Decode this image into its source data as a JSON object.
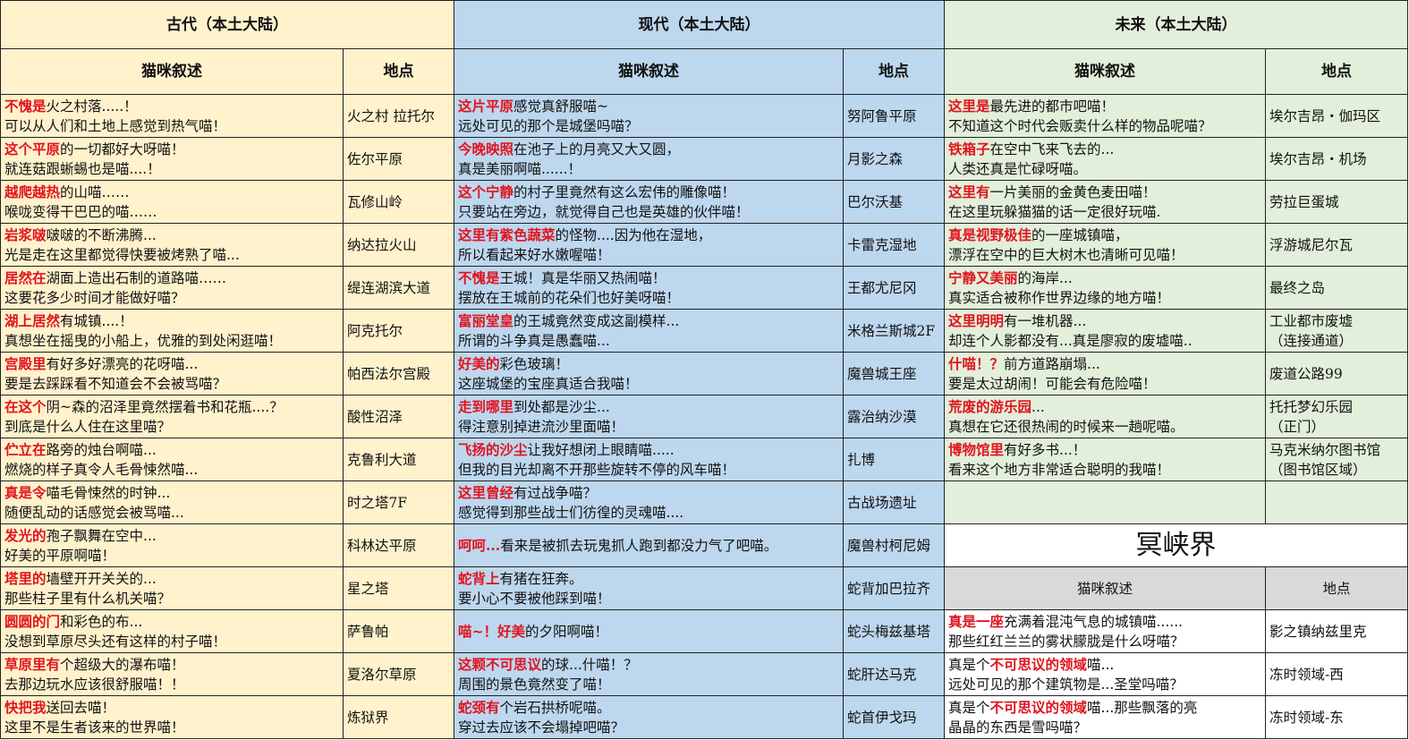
{
  "ancient": {
    "title": "古代（本土大陆）",
    "col_narration": "猫咪叙述",
    "col_location": "地点",
    "rows": [
      {
        "hl": "不愧是",
        "l1": "火之村落.....！",
        "l2": "可以从人们和土地上感觉到热气喵！",
        "loc": "火之村 拉托尔"
      },
      {
        "hl": "这个平原",
        "l1": "的一切都好大呀喵！",
        "l2": "就连菇跟蜥蜴也是喵....！",
        "loc": "佐尔平原"
      },
      {
        "hl": "越爬越热",
        "l1": "的山喵……",
        "l2": "喉咙变得干巴巴的喵……",
        "loc": "瓦修山岭"
      },
      {
        "hl": "岩浆啵",
        "l1": "啵啵的不断沸腾...",
        "l2": "光是走在这里都觉得快要被烤熟了喵...",
        "loc": "纳达拉火山"
      },
      {
        "hl": "居然在",
        "l1": "湖面上造出石制的道路喵……",
        "l2": "这要花多少时间才能做好喵？",
        "loc": "缇连湖滨大道"
      },
      {
        "hl": "湖上居然",
        "l1": "有城镇....！",
        "l2": "真想坐在摇曳的小船上，优雅的到处闲逛喵！",
        "loc": "阿克托尔"
      },
      {
        "hl": "宫殿里",
        "l1": "有好多好漂亮的花呀喵...",
        "l2": "要是去踩踩看不知道会不会被骂喵？",
        "loc": "帕西法尔宫殿"
      },
      {
        "hl": "在这个",
        "l1": "阴~森的沼泽里竟然摆着书和花瓶....？",
        "l2": "到底是什么人住在这里喵？",
        "loc": "酸性沼泽"
      },
      {
        "hl": "伫立在",
        "l1": "路旁的烛台啊喵...",
        "l2": "燃烧的样子真令人毛骨悚然喵...",
        "loc": "克鲁利大道"
      },
      {
        "hl": "真是令",
        "l1": "喵毛骨悚然的时钟...",
        "l2": "随便乱动的话感觉会被骂喵...",
        "loc": "时之塔7F"
      },
      {
        "hl": "发光的",
        "l1": "孢子飘舞在空中...",
        "l2": "好美的平原啊喵！",
        "loc": "科林达平原"
      },
      {
        "hl": "塔里的",
        "l1": "墙壁开开关关的...",
        "l2": "那些柱子里有什么机关喵？",
        "loc": "星之塔"
      },
      {
        "hl": "圆圆的门",
        "l1": "和彩色的布...",
        "l2": "没想到草原尽头还有这样的村子喵！",
        "loc": "萨鲁帕"
      },
      {
        "hl": "草原里有",
        "l1": "个超级大的瀑布喵！",
        "l2": "去那边玩水应该很舒服喵！！",
        "loc": "夏洛尔草原"
      },
      {
        "hl": "快把我",
        "l1": "送回去喵！",
        "l2": "这里不是生者该来的世界喵！",
        "loc": "炼狱界"
      }
    ]
  },
  "modern": {
    "title": "现代（本土大陆）",
    "col_narration": "猫咪叙述",
    "col_location": "地点",
    "rows": [
      {
        "hl": "这片平原",
        "l1": "感觉真舒服喵~",
        "l2": "远处可见的那个是城堡吗喵？",
        "loc": "努阿鲁平原"
      },
      {
        "hl": "今晚映照",
        "l1": "在池子上的月亮又大又圆，",
        "l2": "真是美丽啊喵......！",
        "loc": "月影之森"
      },
      {
        "hl": "这个宁静",
        "l1": "的村子里竟然有这么宏伟的雕像喵！",
        "l2": "只要站在旁边，就觉得自己也是英雄的伙伴喵！",
        "loc": "巴尔沃基"
      },
      {
        "hl": "这里有紫色蔬菜",
        "l1": "的怪物....因为他在湿地，",
        "l2": "所以看起来好水嫩喔喵！",
        "loc": "卡雷克湿地"
      },
      {
        "hl": "不愧是",
        "l1": "王城！真是华丽又热闹喵！",
        "l2": "摆放在王城前的花朵们也好美呀喵！",
        "loc": "王都尤尼冈"
      },
      {
        "hl": "富丽堂皇",
        "l1": "的王城竟然变成这副模样...",
        "l2": "所谓的斗争真是愚蠢喵...",
        "loc": "米格兰斯城2F"
      },
      {
        "hl": "好美的",
        "l1": "彩色玻璃！",
        "l2": "这座城堡的宝座真适合我喵！",
        "loc": "魔兽城王座"
      },
      {
        "hl": "走到哪里",
        "l1": "到处都是沙尘...",
        "l2": "得注意别掉进流沙里面喵！",
        "loc": "露治纳沙漠"
      },
      {
        "hl": "飞扬的沙尘",
        "l1": "让我好想闭上眼睛喵.....",
        "l2": "但我的目光却离不开那些旋转不停的风车喵！",
        "loc": "扎博"
      },
      {
        "hl": "这里曾经",
        "l1": "有过战争喵？",
        "l2": "感觉得到那些战士们彷徨的灵魂喵....",
        "loc": "古战场遗址"
      },
      {
        "hl": "呵呵...",
        "l1": "看来是被抓去玩鬼抓人跑到都没力气了吧喵。",
        "l2": "",
        "loc": "魔兽村柯尼姆"
      },
      {
        "hl": "蛇背上",
        "l1": "有猪在狂奔。",
        "l2": "要小心不要被他踩到喵！",
        "loc": "蛇背加巴拉齐"
      },
      {
        "hl": "喵~！好美",
        "l1": "的夕阳啊喵！",
        "l2": "",
        "loc": "蛇头梅兹基塔"
      },
      {
        "hl": "这颗不可思议",
        "l1": "的球...什喵！？",
        "l2": "周围的景色竟然变了喵！",
        "loc": "蛇肝达马克"
      },
      {
        "hl": "蛇颈有",
        "l1": "个岩石拱桥呢喵。",
        "l2": "穿过去应该不会塌掉吧喵？",
        "loc": "蛇首伊戈玛"
      }
    ]
  },
  "future": {
    "title": "未来（本土大陆）",
    "col_narration": "猫咪叙述",
    "col_location": "地点",
    "rows": [
      {
        "hl": "这里是",
        "l1": "最先进的都市吧喵！",
        "l2": "不知道这个时代会贩卖什么样的物品呢喵？",
        "loc1": "埃尔吉昂・伽玛区",
        "loc2": ""
      },
      {
        "hl": "铁箱子",
        "l1": "在空中飞来飞去的...",
        "l2": "人类还真是忙碌呀喵。",
        "loc1": "埃尔吉昂・机场",
        "loc2": ""
      },
      {
        "hl": "这里有",
        "l1": "一片美丽的金黄色麦田喵！",
        "l2": "在这里玩躲猫猫的话一定很好玩喵.",
        "loc1": "劳拉巨蛋城",
        "loc2": ""
      },
      {
        "hl": "真是视野极佳",
        "l1": "的一座城镇喵，",
        "l2": "漂浮在空中的巨大树木也清晰可见喵！",
        "loc1": "浮游城尼尔瓦",
        "loc2": ""
      },
      {
        "hl": "宁静又美丽",
        "l1": "的海岸...",
        "l2": "真实适合被称作世界边缘的地方喵！",
        "loc1": "最终之岛",
        "loc2": ""
      },
      {
        "hl": "这里明明",
        "l1": "有一堆机器...",
        "l2": "却连个人影都没有...真是廖寂的废墟喵..",
        "loc1": "工业都市废墟",
        "loc2": "（连接通道）"
      },
      {
        "hl": "什喵！？",
        "l1": "前方道路崩塌...",
        "l2": "要是太过胡闹！可能会有危险喵！",
        "loc1": "废道公路99",
        "loc2": ""
      },
      {
        "hl": "荒废的游乐园",
        "l1": "...",
        "l2": "真想在它还很热闹的时候来一趟呢喵。",
        "loc1": "托托梦幻乐园",
        "loc2": "（正门）"
      },
      {
        "hl": "博物馆里",
        "l1": "有好多书...！",
        "l2": "看来这个地方非常适合聪明的我喵！",
        "loc1": "马克米纳尔图书馆",
        "loc2": "（图书馆区域）"
      },
      {
        "hl": "",
        "l1": "",
        "l2": "",
        "loc1": "",
        "loc2": ""
      }
    ]
  },
  "underworld": {
    "title": "冥峡界",
    "col_narration": "猫咪叙述",
    "col_location": "地点",
    "rows": [
      {
        "pre": "",
        "hl": "真是一座",
        "l1": "充满着混沌气息的城镇喵......",
        "l2": "那些红红兰兰的雾状朦胧是什么呀喵？",
        "loc": "影之镇纳兹里克"
      },
      {
        "pre": "真是个",
        "hl": "不可思议的领域",
        "l1": "喵...",
        "l2": "远处可见的那个建筑物是...圣堂吗喵？",
        "loc": "冻时领域-西"
      },
      {
        "pre": "真是个",
        "hl": "不可思议的领域",
        "l1": "喵...那些飘落的亮",
        "l2": "晶晶的东西是雪吗喵？",
        "loc": "冻时领域-东"
      }
    ]
  }
}
